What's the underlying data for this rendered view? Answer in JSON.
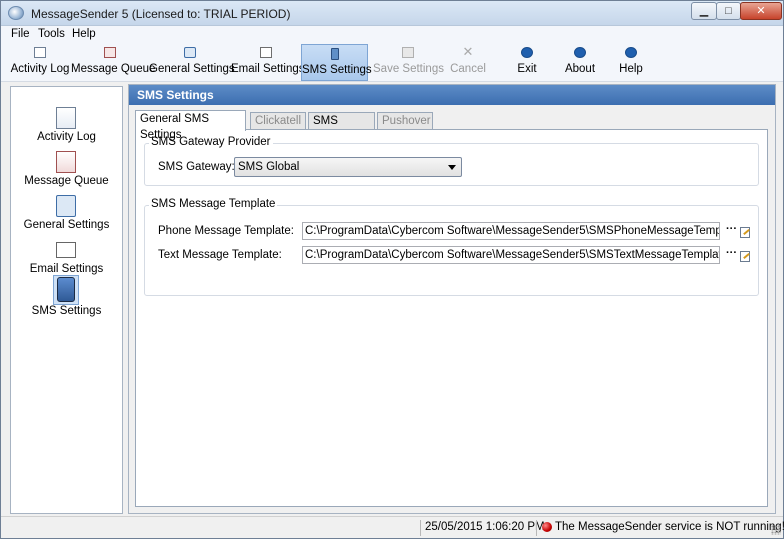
{
  "window": {
    "title": "MessageSender 5   (Licensed to: TRIAL PERIOD)",
    "controls": {
      "minimize": "▁",
      "maximize": "□",
      "close": "✕"
    }
  },
  "menu": {
    "items": [
      "File",
      "Tools",
      "Help"
    ]
  },
  "toolbar": {
    "buttons": [
      {
        "label": "Activity Log",
        "icon": "document-icon"
      },
      {
        "label": "Message Queue",
        "icon": "queue-icon"
      },
      {
        "label": "General Settings",
        "icon": "gear-icon"
      },
      {
        "label": "Email Settings",
        "icon": "mail-icon"
      },
      {
        "label": "SMS Settings",
        "icon": "phone-icon",
        "state": "active"
      },
      {
        "label": "Save Settings",
        "icon": "save-icon",
        "state": "disabled"
      },
      {
        "label": "Cancel",
        "icon": "cancel-icon",
        "state": "disabled"
      },
      {
        "label": "Exit",
        "icon": "exit-icon"
      },
      {
        "label": "About",
        "icon": "info-icon"
      },
      {
        "label": "Help",
        "icon": "help-icon"
      }
    ]
  },
  "nav": {
    "items": [
      {
        "label": "Activity Log",
        "icon": "document-icon"
      },
      {
        "label": "Message Queue",
        "icon": "queue-icon"
      },
      {
        "label": "General Settings",
        "icon": "gear-icon"
      },
      {
        "label": "Email Settings",
        "icon": "mail-icon"
      },
      {
        "label": "SMS Settings",
        "icon": "phone-icon",
        "selected": true
      }
    ]
  },
  "content": {
    "header": "SMS Settings",
    "tabs": [
      {
        "label": "General SMS Settings",
        "state": "active"
      },
      {
        "label": "Clickatell",
        "state": "disabled"
      },
      {
        "label": "SMS Global",
        "state": "enabled"
      },
      {
        "label": "Pushover",
        "state": "disabled"
      }
    ],
    "gateway_group": {
      "title": "SMS Gateway Provider",
      "gateway_label": "SMS Gateway:",
      "gateway_value": "SMS Global"
    },
    "template_group": {
      "title": "SMS Message Template",
      "phone_label": "Phone Message Template:",
      "phone_value": "C:\\ProgramData\\Cybercom Software\\MessageSender5\\SMSPhoneMessageTemplate.tem",
      "text_label": "Text Message Template:",
      "text_value": "C:\\ProgramData\\Cybercom Software\\MessageSender5\\SMSTextMessageTemplate.tem",
      "browse_label": "···"
    }
  },
  "status": {
    "datetime": "25/05/2015 1:06:20 PM",
    "message": "The MessageSender service is NOT running!!!",
    "indicator_color": "#c40000"
  }
}
